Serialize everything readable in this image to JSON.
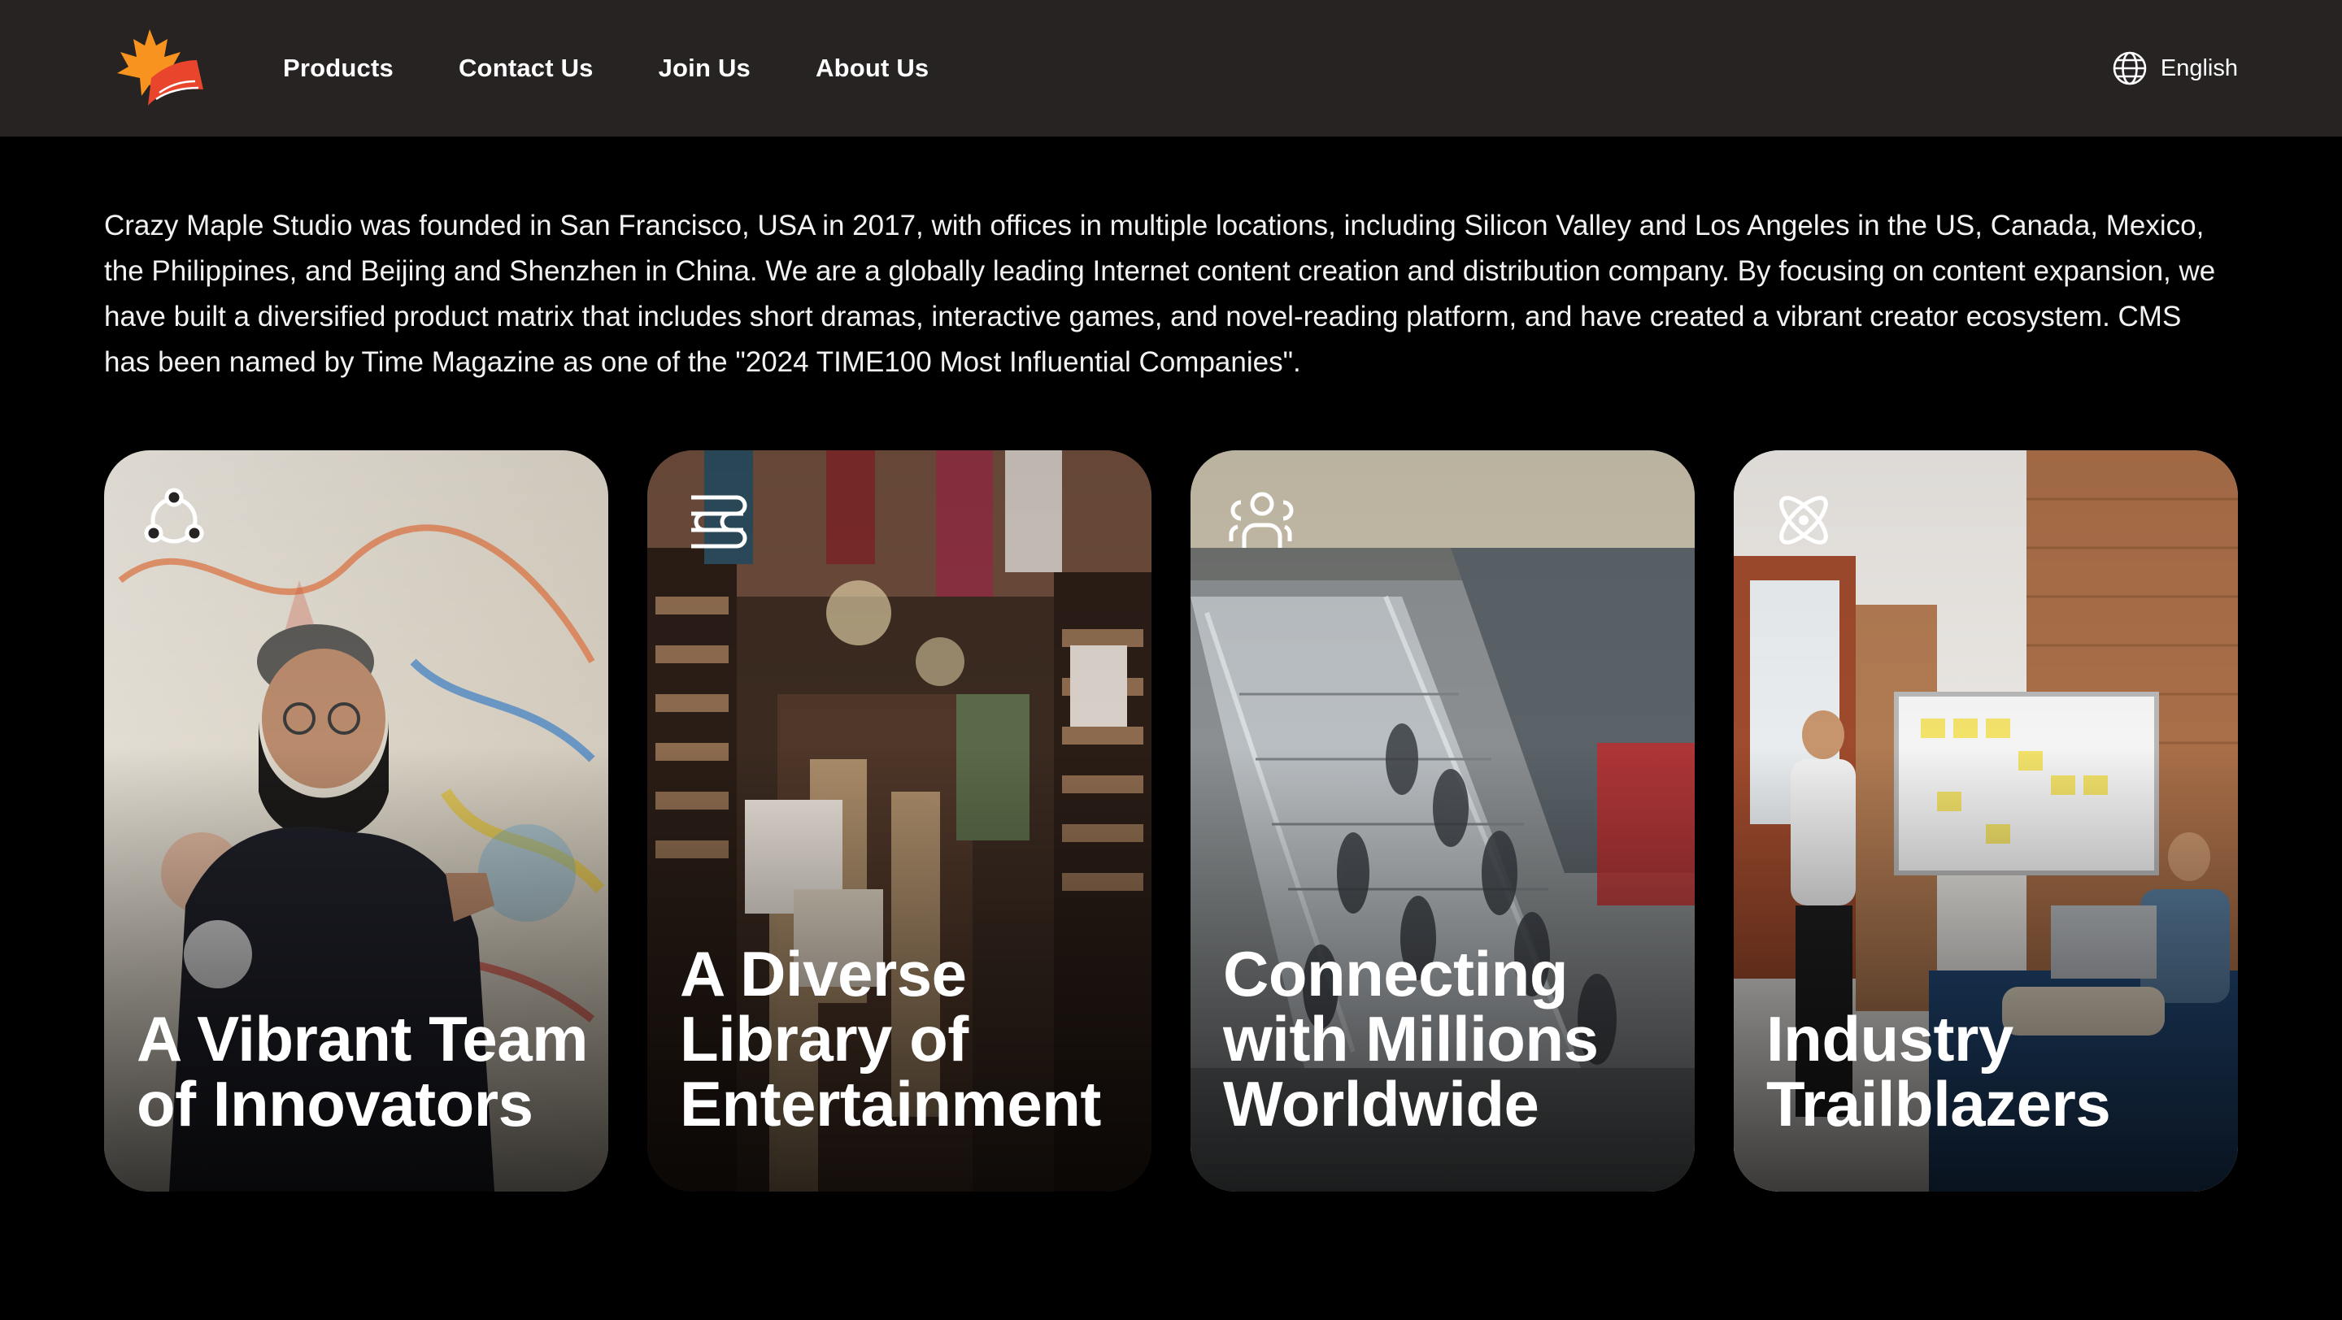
{
  "header": {
    "nav": [
      {
        "label": "Products"
      },
      {
        "label": "Contact Us"
      },
      {
        "label": "Join Us"
      },
      {
        "label": "About Us"
      }
    ],
    "language": {
      "label": "English",
      "icon": "globe-icon"
    },
    "logo_icon": "maple-leaf-book-logo",
    "colors": {
      "background": "#262322",
      "logo_orange": "#F7931E",
      "logo_red": "#E8452C"
    }
  },
  "intro": {
    "text": "Crazy Maple Studio was founded in San Francisco, USA in 2017, with offices in multiple locations, including Silicon Valley and Los Angeles in the US, Canada, Mexico, the Philippines, and Beijing and Shenzhen in China. We are a globally leading Internet content creation and distribution company. By focusing on content expansion, we have built a diversified product matrix that includes short dramas, interactive games, and novel-reading platform, and have created a vibrant creator ecosystem. CMS has been named by Time Magazine as one of the \"2024 TIME100 Most Influential Companies\"."
  },
  "cards": [
    {
      "title": "A Vibrant Team of Innovators",
      "icon": "team-network-icon"
    },
    {
      "title": "A Diverse Library of Entertainment",
      "icon": "books-stack-icon"
    },
    {
      "title": "Connecting with Millions Worldwide",
      "icon": "users-icon"
    },
    {
      "title": "Industry Trailblazers",
      "icon": "atom-icon"
    }
  ]
}
